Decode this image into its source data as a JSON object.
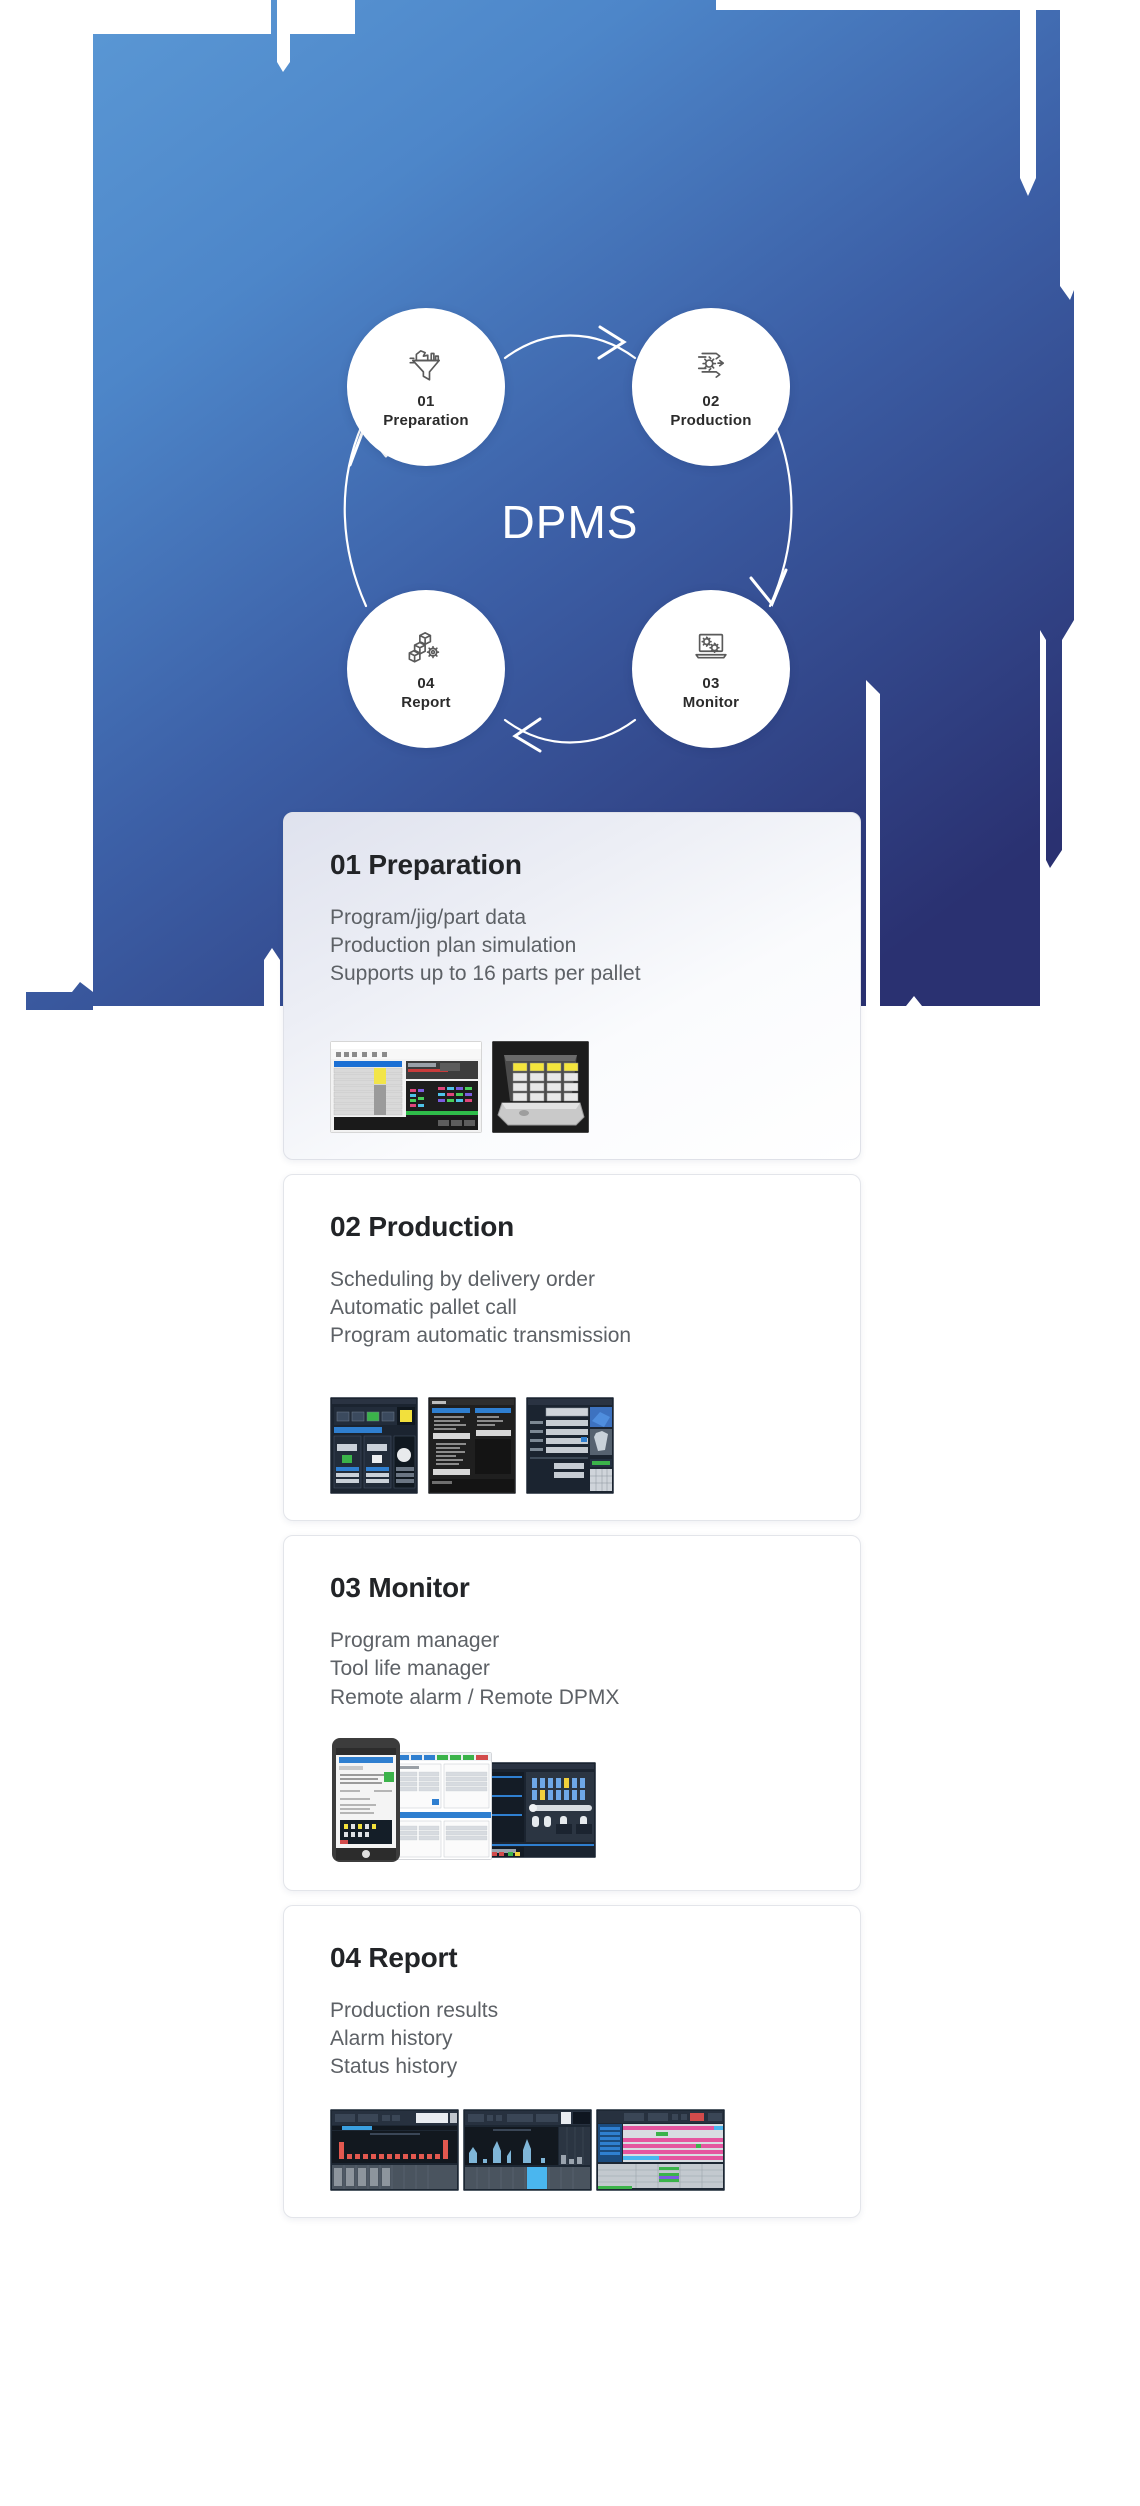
{
  "hero": {
    "center_title": "DPMS",
    "bg_color_top": "#4f8fd0",
    "bg_color_bottom": "#2b3472"
  },
  "cycle": {
    "nodes": [
      {
        "num": "01",
        "label": "Preparation",
        "icon": "funnel-data-icon"
      },
      {
        "num": "02",
        "label": "Production",
        "icon": "gear-arrows-icon"
      },
      {
        "num": "03",
        "label": "Monitor",
        "icon": "laptop-gears-icon"
      },
      {
        "num": "04",
        "label": "Report",
        "icon": "blocks-gear-icon"
      }
    ]
  },
  "cards": [
    {
      "title": "01 Preparation",
      "lines": [
        "Program/jig/part data",
        "Production plan simulation",
        "Supports up to 16 parts per pallet"
      ],
      "shots": [
        "scheduler-table-screenshot",
        "pallet-16-slot-screenshot"
      ]
    },
    {
      "title": "02 Production",
      "lines": [
        "Scheduling by delivery order",
        "Automatic pallet call",
        "Program automatic transmission"
      ],
      "shots": [
        "pallet-status-screenshot",
        "program-list-screenshot",
        "job-setup-screenshot"
      ]
    },
    {
      "title": "03 Monitor",
      "lines": [
        "Program manager",
        "Tool life manager",
        "Remote alarm / Remote DPMX"
      ],
      "shots": [
        "mobile-remote-alarm-screenshot",
        "program-manager-screenshot",
        "tool-life-manager-screenshot"
      ]
    },
    {
      "title": "04 Report",
      "lines": [
        "Production results",
        "Alarm history",
        "Status history"
      ],
      "shots": [
        "production-results-chart-screenshot",
        "alarm-history-chart-screenshot",
        "status-history-gantt-screenshot"
      ]
    }
  ]
}
